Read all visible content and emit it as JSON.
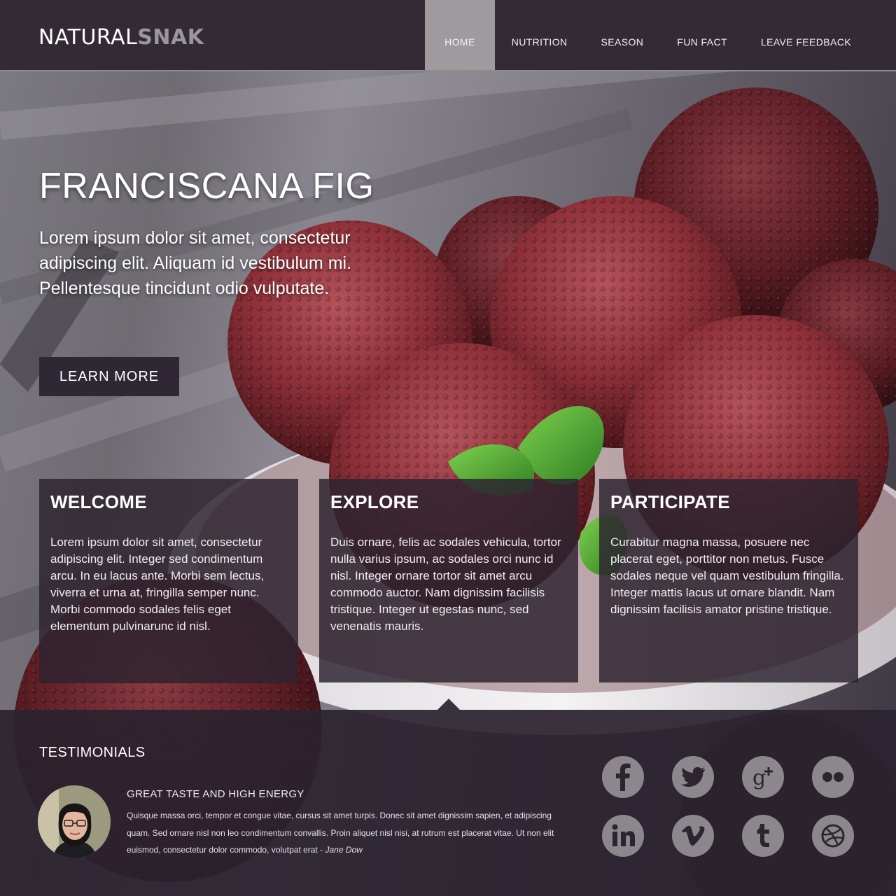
{
  "brand": {
    "part1": "NATURAL",
    "part2": "SNAK"
  },
  "nav": [
    {
      "label": "HOME",
      "active": true
    },
    {
      "label": "NUTRITION",
      "active": false
    },
    {
      "label": "SEASON",
      "active": false
    },
    {
      "label": "FUN FACT",
      "active": false
    },
    {
      "label": "LEAVE FEEDBACK",
      "active": false
    }
  ],
  "hero": {
    "title": "FRANCISCANA FIG",
    "subtitle": "Lorem ipsum dolor sit amet, consectetur adipiscing elit. Aliquam id vestibulum mi. Pellentesque tincidunt odio vulputate.",
    "cta_label": "LEARN MORE"
  },
  "cards": [
    {
      "title": "WELCOME",
      "body": "Lorem ipsum dolor sit amet, consectetur adipiscing elit. Integer sed condimentum arcu. In eu lacus ante. Morbi sem lectus, viverra et urna at, fringilla semper nunc. Morbi commodo sodales felis eget elementum pulvinarunc id nisl."
    },
    {
      "title": "EXPLORE",
      "body": "Duis ornare, felis ac sodales vehicula, tortor nulla varius ipsum, ac sodales orci nunc id nisl. Integer ornare tortor sit amet arcu commodo auctor. Nam dignissim facilisis tristique. Integer ut egestas nunc, sed venenatis mauris."
    },
    {
      "title": "PARTICIPATE",
      "body": "Curabitur magna massa, posuere nec placerat eget, porttitor non metus. Fusce sodales neque vel quam vestibulum fringilla. Integer mattis lacus ut ornare blandit. Nam dignissim facilisis amator pristine tristique."
    }
  ],
  "testimonials": {
    "heading": "TESTIMONIALS",
    "quote_title": "GREAT TASTE AND HIGH ENERGY",
    "quote_body": "Quisque massa orci, tempor et congue vitae, cursus sit amet turpis. Donec sit amet dignissim sapien, et adipiscing quam. Sed ornare nisl non leo condimentum convallis. Proin aliquet nisl nisi, at rutrum est placerat vitae. Ut non elit euismod, consectetur dolor commodo, volutpat erat -",
    "quote_author": "Jane Dow"
  },
  "social": [
    {
      "name": "facebook-icon"
    },
    {
      "name": "twitter-icon"
    },
    {
      "name": "google-plus-icon"
    },
    {
      "name": "flickr-icon"
    },
    {
      "name": "linkedin-icon"
    },
    {
      "name": "vimeo-icon"
    },
    {
      "name": "tumblr-icon"
    },
    {
      "name": "dribbble-icon"
    }
  ],
  "colors": {
    "header_bg": "#332a35",
    "nav_active_bg": "#9e9a9e",
    "panel_bg": "#2d2430",
    "social_icon": "#8b878c",
    "fruit": "#8e2f38"
  }
}
